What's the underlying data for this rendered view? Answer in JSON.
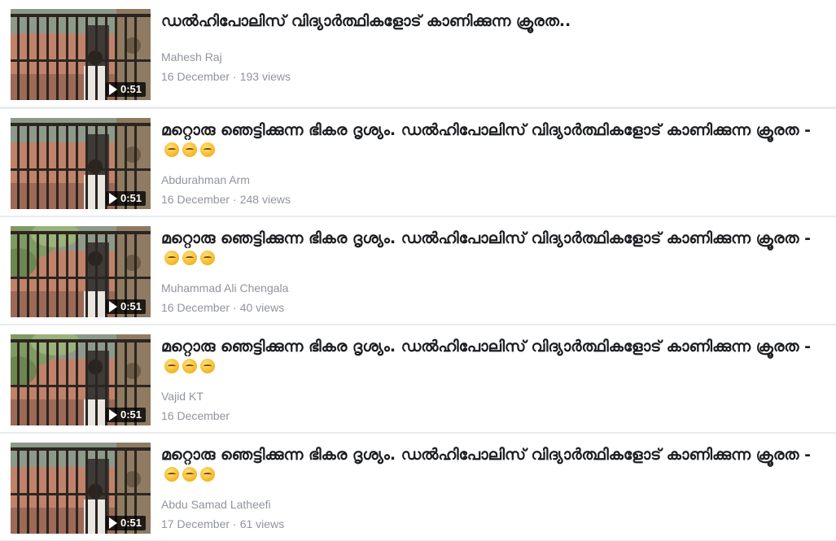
{
  "items": [
    {
      "title": "ഡൽഹിപോലിസ് വിദ്യാർത്ഥികളോട് കാണിക്കുന്ന ക്രൂരത..",
      "emoji_count": 0,
      "author": "Mahesh Raj",
      "date": "16 December",
      "views": "193 views",
      "duration": "0:51"
    },
    {
      "title": "മറ്റൊരു ഞെട്ടിക്കുന്ന ഭികര ദൃശ്യം. ഡൽഹിപോലിസ് വിദ്യാർത്ഥികളോട് കാണിക്കുന്ന ക്രൂരത -",
      "emoji_count": 3,
      "author": "Abdurahman Arm",
      "date": "16 December",
      "views": "248 views",
      "duration": "0:51"
    },
    {
      "title": "മറ്റൊരു ഞെട്ടിക്കുന്ന ഭികര ദൃശ്യം. ഡൽഹിപോലിസ് വിദ്യാർത്ഥികളോട് കാണിക്കുന്ന ക്രൂരത -",
      "emoji_count": 3,
      "author": "Muhammad Ali Chengala",
      "date": "16 December",
      "views": "40 views",
      "duration": "0:51"
    },
    {
      "title": "മറ്റൊരു ഞെട്ടിക്കുന്ന ഭികര ദൃശ്യം. ഡൽഹിപോലിസ് വിദ്യാർത്ഥികളോട് കാണിക്കുന്ന ക്രൂരത -",
      "emoji_count": 3,
      "author": "Vajid KT",
      "date": "16 December",
      "views": "",
      "duration": "0:51"
    },
    {
      "title": "മറ്റൊരു ഞെട്ടിക്കുന്ന ഭികര ദൃശ്യം. ഡൽഹിപോലിസ് വിദ്യാർത്ഥികളോട് കാണിക്കുന്ന ക്രൂരത -",
      "emoji_count": 3,
      "author": "Abdu Samad Latheefi",
      "date": "17 December",
      "views": "61 views",
      "duration": "0:51"
    }
  ],
  "meta_separator": "·",
  "emoji_icon": "sleepy-face-emoji",
  "colors": {
    "title": "#1c1e21",
    "secondary": "#90949c",
    "background": "#e9ebee",
    "card": "#ffffff"
  }
}
